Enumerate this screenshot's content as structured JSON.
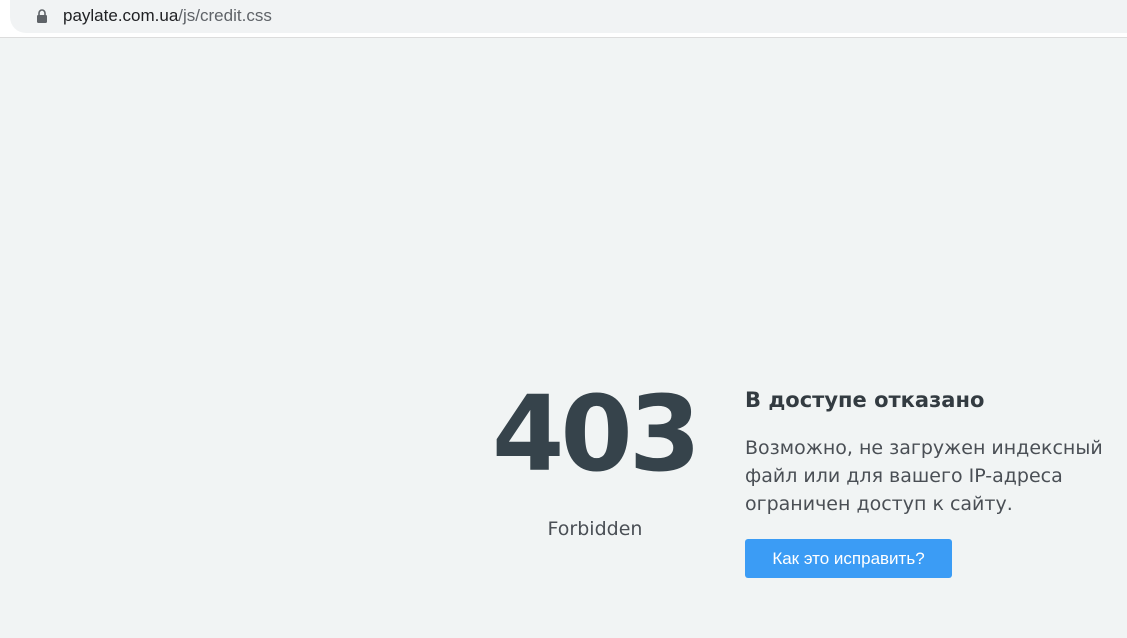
{
  "browser": {
    "url_host": "paylate.com.ua",
    "url_path": "/js/credit.css",
    "lock_icon": "lock-icon"
  },
  "error": {
    "code": "403",
    "code_text": "Forbidden",
    "title": "В доступе отказано",
    "description_lines": [
      "Возможно, не загружен индексный",
      "файл или для вашего IP-адреса",
      "ограничен доступ к сайту."
    ],
    "button_label": "Как это исправить?"
  },
  "colors": {
    "page_background": "#f1f4f4",
    "heading": "#36434b",
    "button": "#3b9cf5"
  }
}
